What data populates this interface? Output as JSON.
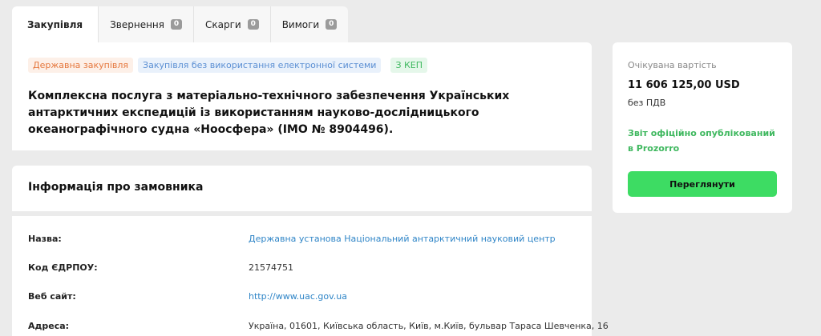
{
  "tabs": [
    {
      "label": "Закупівля",
      "badge": null
    },
    {
      "label": "Звернення",
      "badge": "0"
    },
    {
      "label": "Скарги",
      "badge": "0"
    },
    {
      "label": "Вимоги",
      "badge": "0"
    }
  ],
  "tender": {
    "chips": [
      "Державна закупівля",
      "Закупівля без використання електронної системи",
      "З КЕП"
    ],
    "title": "Комплексна послуга з матеріально-технічного забезпечення Українських антарктичних експедицій із використанням науково-дослідницького океанографічного судна «Ноосфера» (IMO № 8904496)."
  },
  "customer": {
    "heading": "Інформація про замовника",
    "rows": [
      {
        "label": "Назва:",
        "value": "Державна установа Національний антарктичний науковий центр"
      },
      {
        "label": "Код ЄДРПОУ:",
        "value": "21574751"
      },
      {
        "label": "Веб сайт:",
        "value": "http://www.uac.gov.ua"
      },
      {
        "label": "Адреса:",
        "value": "Україна, 01601, Київська область, Київ, м.Київ, бульвар Тараса Шевченка, 16"
      }
    ]
  },
  "side": {
    "expected_label": "Очікувана вартість",
    "amount": "11 606 125,00 USD",
    "vat": "без ПДВ",
    "published": "Звіт офіційно опублікований в Prozorro",
    "button": "Переглянути"
  },
  "colors": {
    "background": "#ebebeb",
    "link": "#2f85c7",
    "accent_green": "#3ddc63",
    "published_green": "#3fb85f"
  }
}
